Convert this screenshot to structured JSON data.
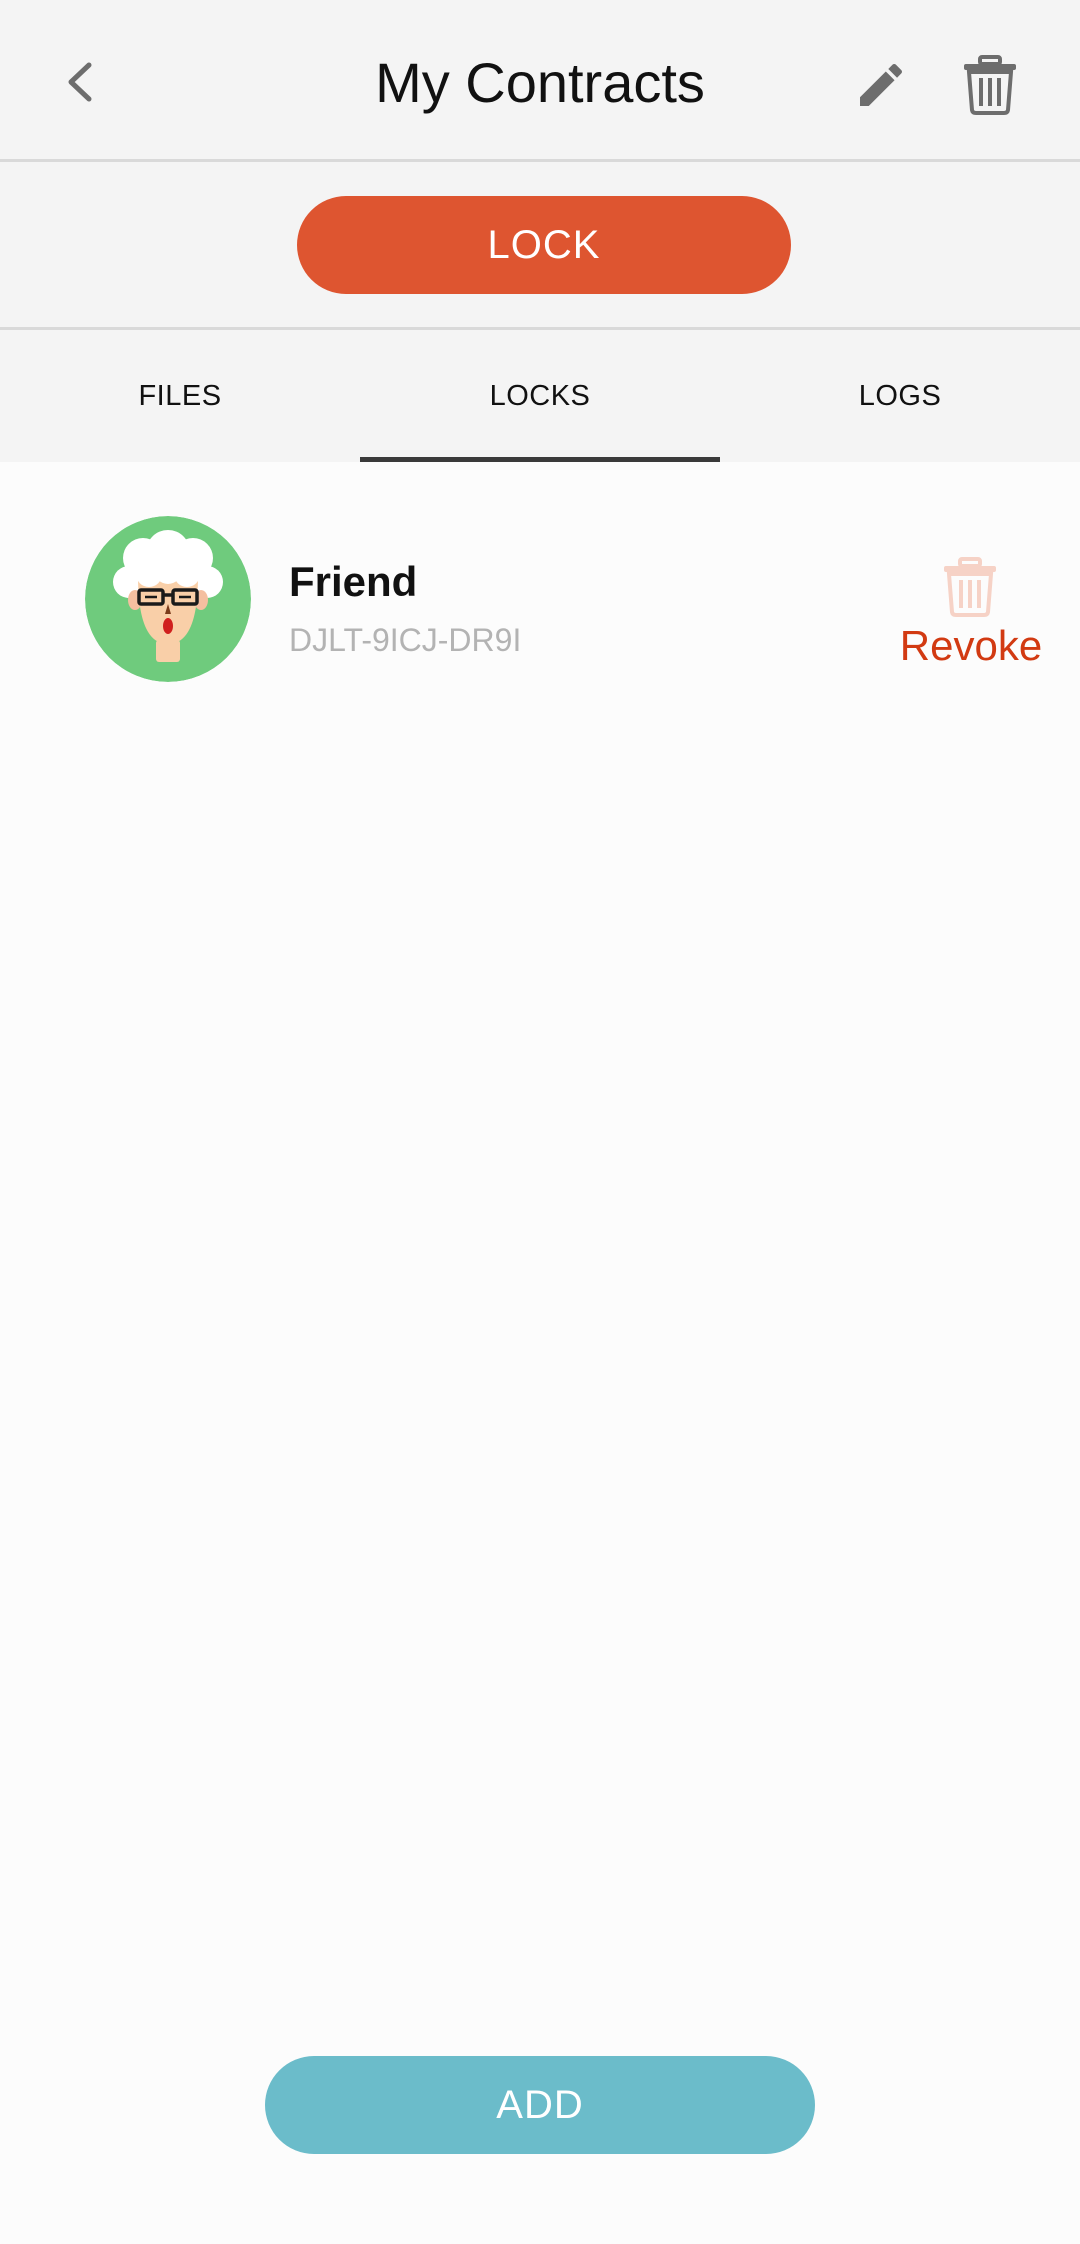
{
  "header": {
    "title": "My Contracts"
  },
  "lock_button": {
    "label": "LOCK"
  },
  "tabs": [
    {
      "label": "FILES",
      "selected": false
    },
    {
      "label": "LOCKS",
      "selected": true
    },
    {
      "label": "LOGS",
      "selected": false
    }
  ],
  "locks": [
    {
      "name": "Friend",
      "code": "DJLT-9ICJ-DR9I",
      "avatar_icon": "elderly-person-avatar-icon",
      "action_label": "Revoke",
      "action_icon": "trash-icon"
    }
  ],
  "add_button": {
    "label": "ADD"
  },
  "colors": {
    "lock_button": "#de5530",
    "add_button": "#6bbcca",
    "revoke_text": "#d23a12",
    "revoke_icon": "#f6d2c6",
    "avatar_bg": "#6fcb7d",
    "header_icon": "#6d6d6d"
  }
}
